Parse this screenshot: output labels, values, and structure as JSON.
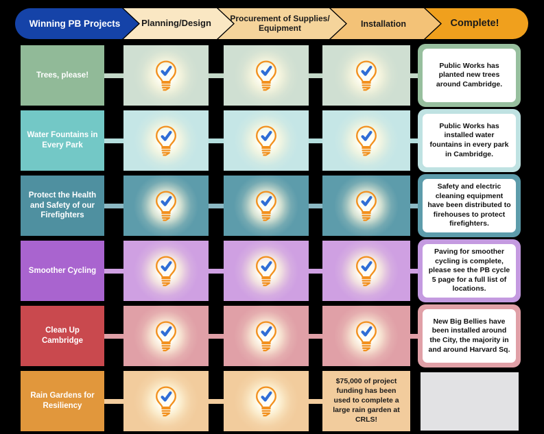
{
  "title": "Winning PB Projects Progress Tracker",
  "header": {
    "stages": [
      {
        "label": "Winning PB Projects",
        "color": "#1543a8",
        "text_color": "#ffffff"
      },
      {
        "label": "Planning/Design",
        "color": "#fae7c3",
        "text_color": "#1a1a1a"
      },
      {
        "label": "Procurement of Supplies/ Equipment",
        "color": "#f5d49b",
        "text_color": "#1a1a1a"
      },
      {
        "label": "Installation",
        "color": "#f3c277",
        "text_color": "#1a1a1a"
      },
      {
        "label": "Complete!",
        "color": "#f0a01d",
        "text_color": "#1a1a1a"
      }
    ]
  },
  "icons": {
    "completed": "lightbulb-check-icon"
  },
  "rows": [
    {
      "label": "Trees, please!",
      "label_color": "#91ba98",
      "cell_color": "#cfdfd2",
      "connector_color": "#c3d8c8",
      "stages": [
        {
          "type": "icon",
          "icon": "lightbulb-check-icon"
        },
        {
          "type": "icon",
          "icon": "lightbulb-check-icon"
        },
        {
          "type": "icon",
          "icon": "lightbulb-check-icon"
        }
      ],
      "callout": {
        "text": "Public Works has planted new trees around Cambridge.",
        "border_color": "#97bf9e",
        "empty": false
      }
    },
    {
      "label": "Water Fountains in Every Park",
      "label_color": "#73c8c6",
      "cell_color": "#c5e6e6",
      "connector_color": "#b4dedd",
      "stages": [
        {
          "type": "icon",
          "icon": "lightbulb-check-icon"
        },
        {
          "type": "icon",
          "icon": "lightbulb-check-icon"
        },
        {
          "type": "icon",
          "icon": "lightbulb-check-icon"
        }
      ],
      "callout": {
        "text": "Public Works has installed water fountains in every park in Cambridge.",
        "border_color": "#bfe2e2",
        "empty": false
      }
    },
    {
      "label": "Protect the Health and Safety of our Firefighters",
      "label_color": "#4f90a0",
      "cell_color": "#5d9cab",
      "connector_color": "#8cb9c4",
      "stages": [
        {
          "type": "icon",
          "icon": "lightbulb-check-icon"
        },
        {
          "type": "icon",
          "icon": "lightbulb-check-icon"
        },
        {
          "type": "icon",
          "icon": "lightbulb-check-icon"
        }
      ],
      "callout": {
        "text": "Safety and electric cleaning equipment have been distributed to firehouses to protect firefighters.",
        "border_color": "#5d9cab",
        "empty": false
      }
    },
    {
      "label": "Smoother Cycling",
      "label_color": "#a964cf",
      "cell_color": "#cfa0e2",
      "connector_color": "#cfa0e2",
      "stages": [
        {
          "type": "icon",
          "icon": "lightbulb-check-icon"
        },
        {
          "type": "icon",
          "icon": "lightbulb-check-icon"
        },
        {
          "type": "icon",
          "icon": "lightbulb-check-icon"
        }
      ],
      "callout": {
        "text": "Paving for smoother cycling is complete, please see the PB cycle 5 page for a full list of locations.",
        "border_color": "#c49ae0",
        "empty": false
      }
    },
    {
      "label": "Clean Up Cambridge",
      "label_color": "#c9494e",
      "cell_color": "#e0a0a7",
      "connector_color": "#e0a0a7",
      "stages": [
        {
          "type": "icon",
          "icon": "lightbulb-check-icon"
        },
        {
          "type": "icon",
          "icon": "lightbulb-check-icon"
        },
        {
          "type": "icon",
          "icon": "lightbulb-check-icon"
        }
      ],
      "callout": {
        "text": "New Big Bellies have been installed around the City, the majority in and around Harvard Sq.",
        "border_color": "#e0a0a7",
        "empty": false
      }
    },
    {
      "label": "Rain Gardens for Resiliency",
      "label_color": "#e1973c",
      "cell_color": "#f2cc9d",
      "connector_color": "#f2cc9d",
      "stages": [
        {
          "type": "icon",
          "icon": "lightbulb-check-icon"
        },
        {
          "type": "icon",
          "icon": "lightbulb-check-icon"
        },
        {
          "type": "text",
          "text": "$75,000 of project funding has been used to complete a large rain garden at CRLS!"
        }
      ],
      "callout": {
        "text": "",
        "border_color": "#e2e2e4",
        "empty": true
      }
    }
  ]
}
